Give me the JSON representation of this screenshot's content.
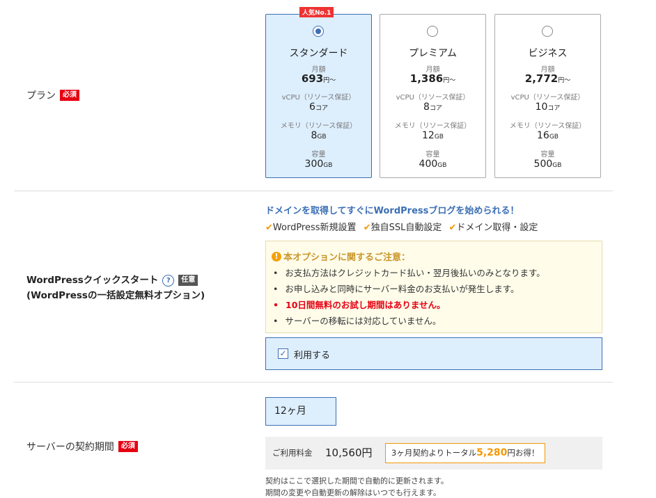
{
  "plan_row": {
    "label": "プラン",
    "required_badge": "必須"
  },
  "plans": [
    {
      "name": "スタンダード",
      "price_label": "月額",
      "price": "693",
      "price_unit": "円〜",
      "vcpu_label": "vCPU（リソース保証）",
      "vcpu": "6",
      "vcpu_unit": "コア",
      "memory_label": "メモリ（リソース保証）",
      "memory": "8",
      "memory_unit": "GB",
      "storage_label": "容量",
      "storage": "300",
      "storage_unit": "GB",
      "ribbon": "人気No.1",
      "selected": true
    },
    {
      "name": "プレミアム",
      "price_label": "月額",
      "price": "1,386",
      "price_unit": "円〜",
      "vcpu_label": "vCPU（リソース保証）",
      "vcpu": "8",
      "vcpu_unit": "コア",
      "memory_label": "メモリ（リソース保証）",
      "memory": "12",
      "memory_unit": "GB",
      "storage_label": "容量",
      "storage": "400",
      "storage_unit": "GB",
      "selected": false
    },
    {
      "name": "ビジネス",
      "price_label": "月額",
      "price": "2,772",
      "price_unit": "円〜",
      "vcpu_label": "vCPU（リソース保証）",
      "vcpu": "10",
      "vcpu_unit": "コア",
      "memory_label": "メモリ（リソース保証）",
      "memory": "16",
      "memory_unit": "GB",
      "storage_label": "容量",
      "storage": "500",
      "storage_unit": "GB",
      "selected": false
    }
  ],
  "wp_row": {
    "label_line1": "WordPressクイックスタート",
    "help_icon": "?",
    "optional_badge": "任意",
    "label_line2": "(WordPressの一括設定無料オプション)",
    "promo_heading": "ドメインを取得してすぐにWordPressブログを始められる！",
    "features": [
      "WordPress新規設置",
      "独自SSL自動設定",
      "ドメイン取得・設定"
    ],
    "notice_title": "本オプションに関するご注意：",
    "notice_icon": "!",
    "notice_items": [
      "お支払方法はクレジットカード払い・翌月後払いのみとなります。",
      "お申し込みと同時にサーバー料金のお支払いが発生します。",
      "10日間無料のお試し期間はありません。",
      "サーバーの移転には対応していません。"
    ],
    "use_label": "利用する",
    "use_checked": true
  },
  "period_row": {
    "label": "サーバーの契約期間",
    "required_badge": "必須",
    "selected_period": "12ヶ月",
    "fee_label": "ご利用料金",
    "fee_amount": "10,560円",
    "savings_prefix": "3ヶ月契約よりトータル",
    "savings_amount": "5,280",
    "savings_suffix": "円お得！",
    "note_line1": "契約はここで選択した期間で自動的に更新されます。",
    "note_line2": "期間の変更や自動更新の解除はいつでも行えます。"
  },
  "colors": {
    "accent": "#3c6fb5",
    "required": "#e60012",
    "orange": "#f39800",
    "selected_bg": "#ddeefd"
  }
}
